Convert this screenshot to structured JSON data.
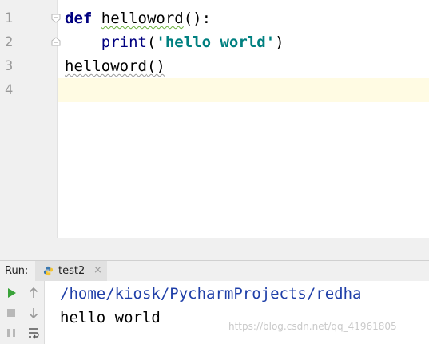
{
  "editor": {
    "line_numbers": [
      "1",
      "2",
      "3",
      "4"
    ],
    "lines": {
      "l1": {
        "kw": "def",
        "name": "helloword",
        "rest": "():"
      },
      "l2": {
        "indent": "    ",
        "builtin": "print",
        "open": "(",
        "string": "'hello world'",
        "close": ")"
      },
      "l3": {
        "call": "helloword",
        "rest": "()"
      }
    }
  },
  "run_panel": {
    "label": "Run:",
    "tab": {
      "name": "test2",
      "close": "×"
    },
    "console": {
      "path": "/home/kiosk/PycharmProjects/redha",
      "output": "hello world"
    }
  },
  "watermark": "https://blog.csdn.net/qq_41961805",
  "colors": {
    "keyword": "#000080",
    "string": "#008080",
    "caret_row": "#fffbe3",
    "run_green": "#3aa33a",
    "path": "#1f3fa8"
  },
  "icons": {
    "fold_start": "fold-marker-icon",
    "fold_end": "fold-end-icon",
    "tab": "python-icon",
    "run": "play-icon",
    "stop": "stop-icon",
    "pause": "pause-icon",
    "up": "arrow-up-icon",
    "down": "arrow-down-icon",
    "wrap": "soft-wrap-icon"
  }
}
